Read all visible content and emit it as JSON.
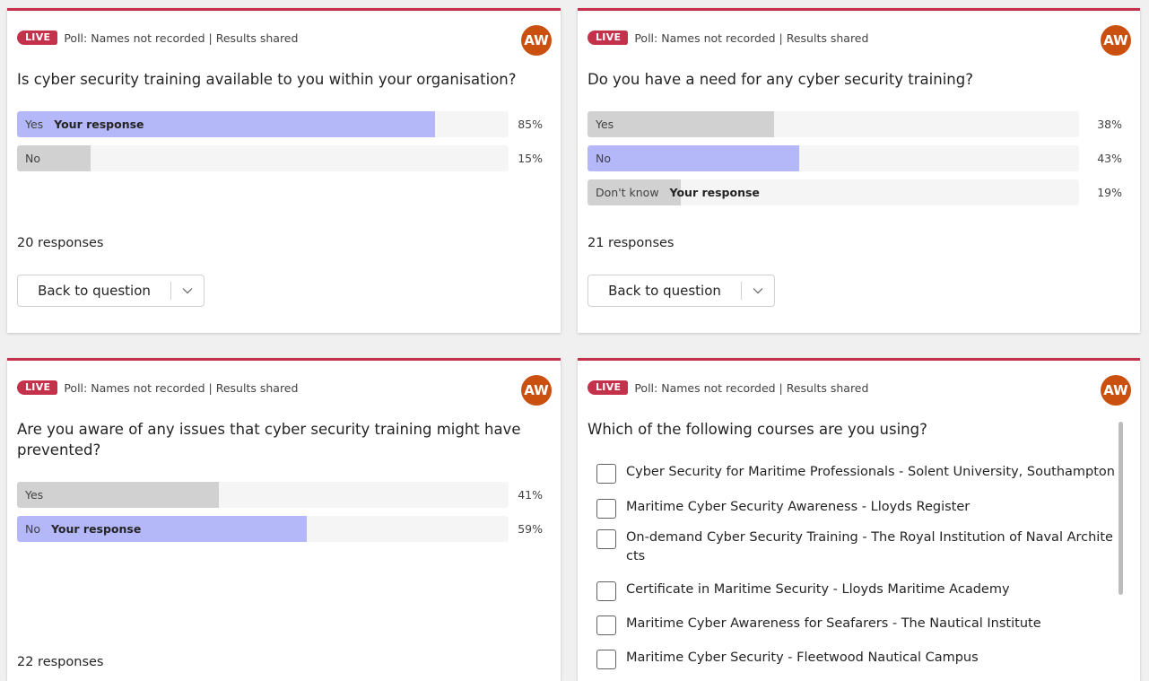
{
  "colors": {
    "accent": "#c4314b",
    "selected_fill": "#b4b8f8",
    "other_fill": "#d1d1d1",
    "track": "#f5f5f5",
    "avatar": "#ca5010"
  },
  "polls": [
    {
      "live_badge": "LIVE",
      "meta": "Poll: Names not recorded | Results shared",
      "avatar": "AW",
      "question": "Is cyber security training available to you within your organisation?",
      "options": [
        {
          "label": "Yes",
          "response_tag": "Your response",
          "percent_text": "85%",
          "fraction": 0.85,
          "selected": true
        },
        {
          "label": "No",
          "response_tag": "",
          "percent_text": "15%",
          "fraction": 0.15,
          "selected": false
        }
      ],
      "responses": "20 responses",
      "back_label": "Back to question"
    },
    {
      "live_badge": "LIVE",
      "meta": "Poll: Names not recorded | Results shared",
      "avatar": "AW",
      "question": "Do you have a need for any cyber security training?",
      "options": [
        {
          "label": "Yes",
          "response_tag": "",
          "percent_text": "38%",
          "fraction": 0.38,
          "selected": false
        },
        {
          "label": "No",
          "response_tag": "",
          "percent_text": "43%",
          "fraction": 0.43,
          "selected": true
        },
        {
          "label": "Don't know",
          "response_tag": "Your response",
          "percent_text": "19%",
          "fraction": 0.19,
          "selected": false
        }
      ],
      "responses": "21 responses",
      "back_label": "Back to question"
    },
    {
      "live_badge": "LIVE",
      "meta": "Poll: Names not recorded | Results shared",
      "avatar": "AW",
      "question": "Are you aware of any issues that cyber security training might have prevented?",
      "options": [
        {
          "label": "Yes",
          "response_tag": "",
          "percent_text": "41%",
          "fraction": 0.41,
          "selected": false
        },
        {
          "label": "No",
          "response_tag": "Your response",
          "percent_text": "59%",
          "fraction": 0.59,
          "selected": true
        }
      ],
      "responses": "22 responses"
    },
    {
      "live_badge": "LIVE",
      "meta": "Poll: Names not recorded | Results shared",
      "avatar": "AW",
      "question": "Which of the following courses are you using?",
      "choices": [
        "Cyber Security for Maritime Professionals - Solent University, Southampton",
        "Maritime Cyber Security Awareness - Lloyds Register",
        "On-demand Cyber Security Training - The Royal Institution of Naval Archite cts",
        "Certificate in Maritime Security - Lloyds Maritime Academy",
        "Maritime Cyber Awareness for Seafarers - The Nautical Institute",
        "Maritime Cyber Security - Fleetwood Nautical Campus"
      ]
    }
  ]
}
